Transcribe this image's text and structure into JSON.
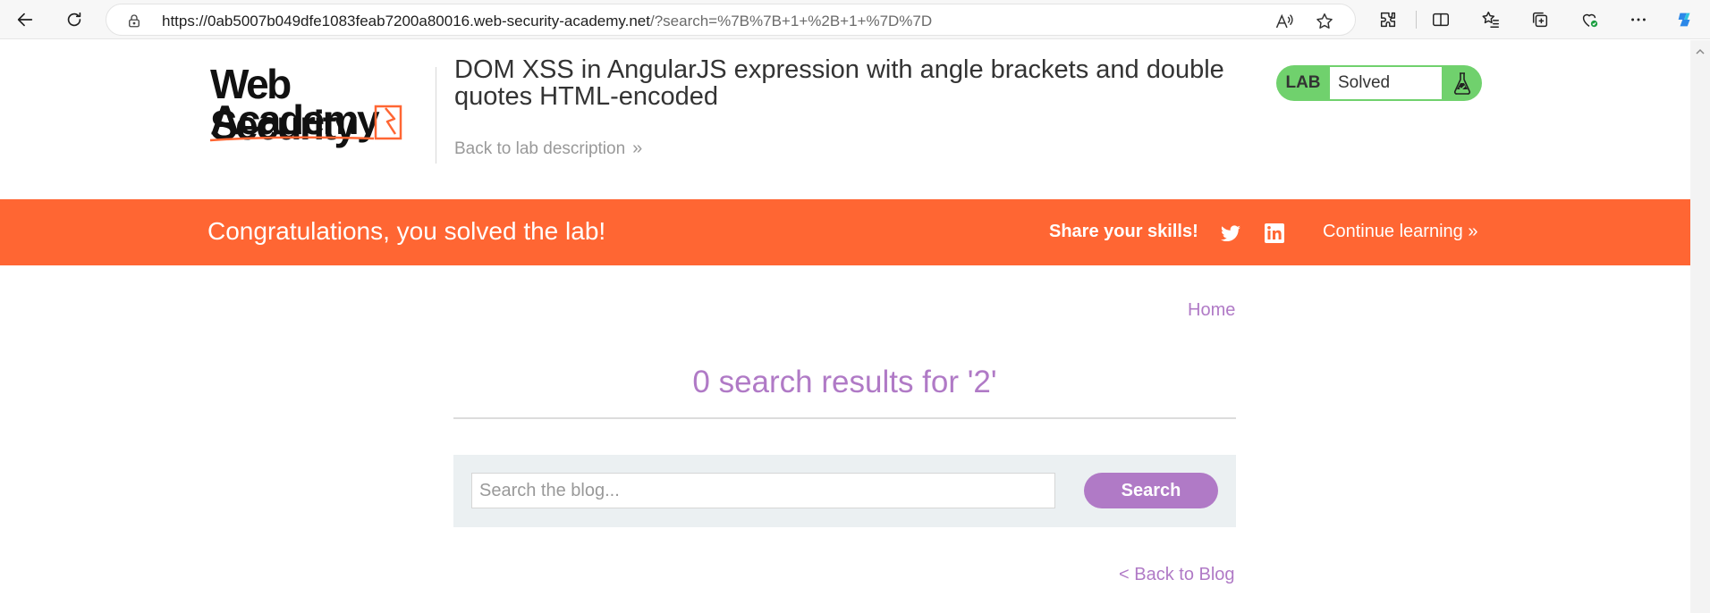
{
  "browser": {
    "url_host": "https://0ab5007b049dfe1083feab7200a80016.web-security-academy.net",
    "url_rest": "/?search=%7B%7B+1+%2B+1+%7D%7D"
  },
  "header": {
    "logo_line1": "Web Security",
    "logo_line2": "Academy",
    "lab_title": "DOM XSS in AngularJS expression with angle brackets and double quotes HTML-encoded",
    "back_link": "Back to lab description",
    "back_chevron": "»",
    "badge_tag": "LAB",
    "badge_status": "Solved"
  },
  "banner": {
    "message": "Congratulations, you solved the lab!",
    "share_label": "Share your skills!",
    "continue_label": "Continue learning",
    "continue_chevron": "»"
  },
  "main": {
    "home_link": "Home",
    "results_title": "0 search results for '2'",
    "search_placeholder": "Search the blog...",
    "search_button": "Search",
    "back_blog": "< Back to Blog"
  },
  "colors": {
    "banner": "#ff6633",
    "accent_purple": "#b07ac6",
    "badge_green": "#70d16d",
    "search_panel": "#ebf0f2"
  }
}
